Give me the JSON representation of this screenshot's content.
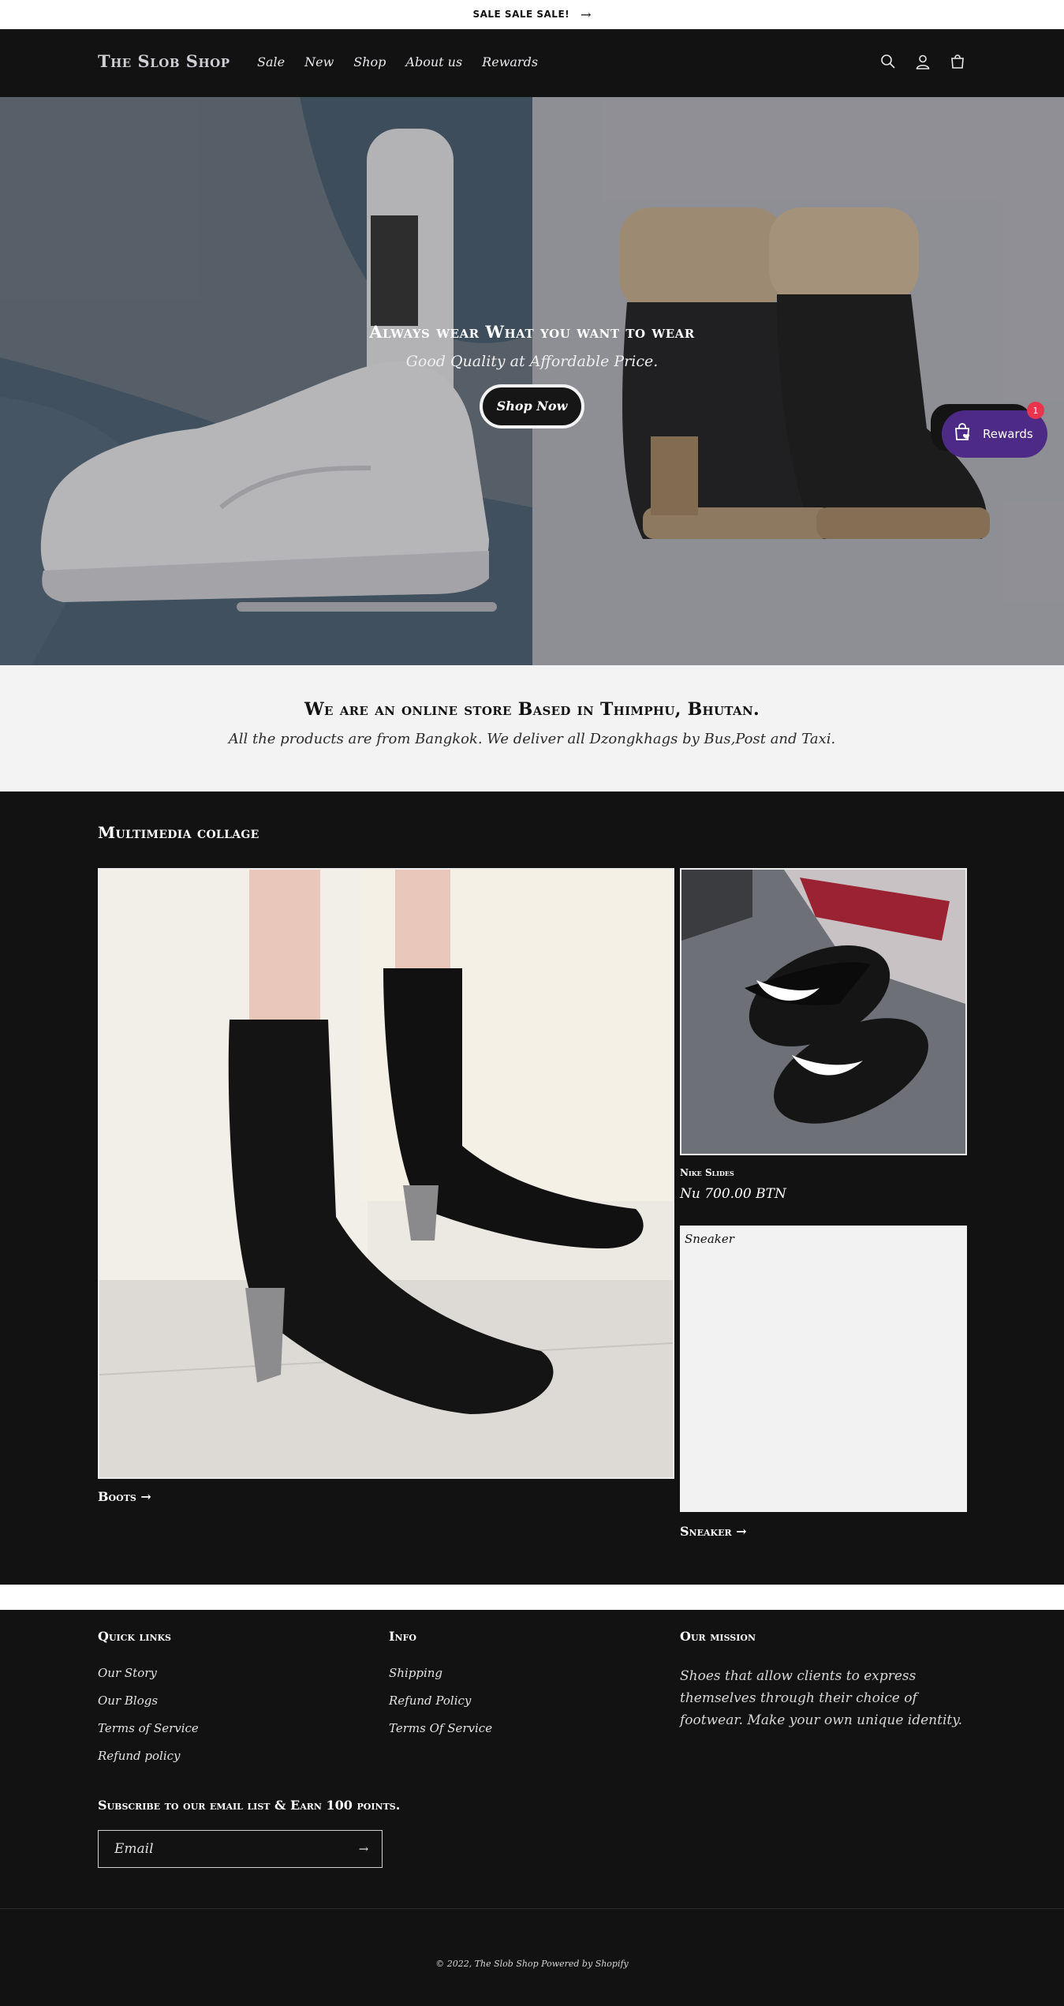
{
  "announcement": {
    "text": "SALE SALE SALE!",
    "arrow_icon": "arrow-right-icon"
  },
  "header": {
    "logo": "The Slob Shop",
    "nav": [
      "Sale",
      "New",
      "Shop",
      "About us",
      "Rewards"
    ],
    "icons": [
      "search-icon",
      "account-icon",
      "cart-icon"
    ]
  },
  "hero": {
    "title": "Always wear What you want to wear",
    "subtitle": "Good Quality at Affordable Price.",
    "button": "Shop Now"
  },
  "rewards": {
    "label": "Rewards",
    "badge": "1",
    "icon": "rewards-bag-icon"
  },
  "intro": {
    "title": "We are an online store Based in Thimphu, Bhutan.",
    "text": "All the products are from Bangkok. We deliver all Dzongkhags by Bus,Post and Taxi."
  },
  "collage": {
    "title": "Multimedia collage",
    "boots_link": "Boots",
    "product": {
      "name": "Nike Slides",
      "price": "Nu 700.00 BTN"
    },
    "sneaker_card_label": "Sneaker",
    "sneaker_link": "Sneaker",
    "arrow": "→"
  },
  "footer": {
    "quick_links": {
      "title": "Quick links",
      "items": [
        "Our Story",
        "Our Blogs",
        "Terms of Service",
        "Refund policy"
      ]
    },
    "info": {
      "title": "Info",
      "items": [
        "Shipping",
        "Refund Policy",
        "Terms Of Service"
      ]
    },
    "mission": {
      "title": "Our mission",
      "text": "Shoes that allow clients to express themselves through their choice of footwear. Make your own unique identity."
    },
    "subscribe": {
      "title": "Subscribe to our email list & Earn 100 points.",
      "placeholder": "Email"
    },
    "copyright": "© 2022, The Slob Shop Powered by Shopify"
  },
  "colors": {
    "header_bg": "#121212",
    "rewards_purple": "#4d2a86",
    "badge_red": "#e8344c",
    "intro_bg": "#f3f3f3"
  }
}
